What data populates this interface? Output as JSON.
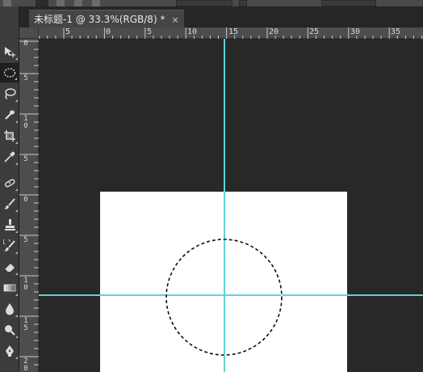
{
  "document": {
    "tab_title": "未标题-1 @ 33.3%(RGB/8) *",
    "tab_close": "×"
  },
  "rulers": {
    "horizontal_labels": [
      "5",
      "0",
      "5",
      "10",
      "15",
      "20",
      "25",
      "30",
      "35"
    ],
    "vertical_labels": [
      "0",
      "5",
      "10",
      "5",
      "0",
      "5",
      "10",
      "15",
      "20"
    ]
  },
  "toolbar": {
    "tools": [
      {
        "name": "move-tool",
        "icon": "move-icon"
      },
      {
        "name": "elliptical-marquee-tool",
        "icon": "ellipse-marquee-icon",
        "active": true
      },
      {
        "name": "lasso-tool",
        "icon": "lasso-icon"
      },
      {
        "name": "quick-selection-tool",
        "icon": "quick-selection-icon"
      },
      {
        "name": "crop-tool",
        "icon": "crop-icon"
      },
      {
        "name": "eyedropper-tool",
        "icon": "eyedropper-icon"
      },
      {
        "name": "spot-healing-tool",
        "icon": "healing-brush-icon"
      },
      {
        "name": "brush-tool",
        "icon": "brush-icon"
      },
      {
        "name": "clone-stamp-tool",
        "icon": "stamp-icon"
      },
      {
        "name": "history-brush-tool",
        "icon": "history-brush-icon"
      },
      {
        "name": "eraser-tool",
        "icon": "eraser-icon"
      },
      {
        "name": "gradient-tool",
        "icon": "gradient-icon"
      },
      {
        "name": "blur-tool",
        "icon": "blur-drop-icon"
      },
      {
        "name": "dodge-tool",
        "icon": "dodge-icon"
      },
      {
        "name": "pen-tool",
        "icon": "pen-icon"
      }
    ]
  },
  "colors": {
    "workspace": "#282828",
    "canvas": "#ffffff",
    "guide": "#5fd3d3",
    "ruler": "#4d4d4d"
  }
}
